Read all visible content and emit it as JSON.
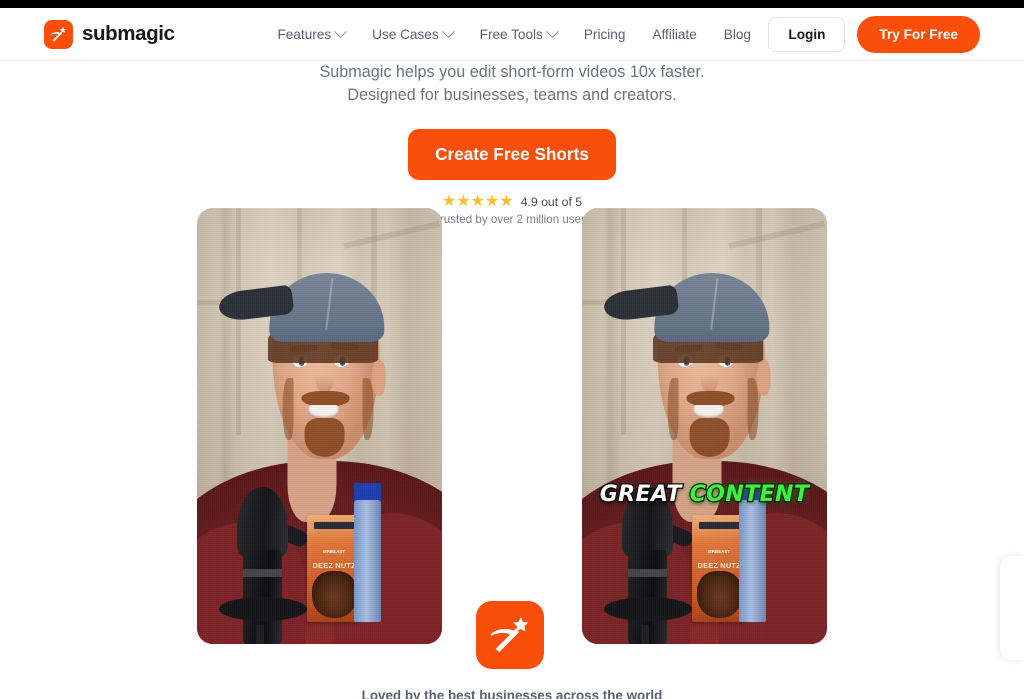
{
  "brand": {
    "name": "submagic",
    "logo_icon": "magic-wand-icon"
  },
  "nav": {
    "links": [
      {
        "label": "Features",
        "has_dropdown": true
      },
      {
        "label": "Use Cases",
        "has_dropdown": true
      },
      {
        "label": "Free Tools",
        "has_dropdown": true
      },
      {
        "label": "Pricing",
        "has_dropdown": false
      },
      {
        "label": "Affiliate",
        "has_dropdown": false
      },
      {
        "label": "Blog",
        "has_dropdown": false
      }
    ],
    "login_label": "Login",
    "try_label": "Try For Free"
  },
  "hero": {
    "subtitle_line1": "Submagic helps you edit short-form videos 10x faster.",
    "subtitle_line2": "Designed for businesses, teams and creators.",
    "cta_label": "Create Free Shorts",
    "stars": "★★★★★",
    "rating_text": "4.9 out of 5",
    "trusted_text": "Trusted by over 2 million users"
  },
  "comparison": {
    "left_video_alt": "original-video-before",
    "right_video_alt": "captioned-video-after",
    "center_icon": "magic-wand-icon",
    "caption_word1": "GREAT",
    "caption_word2": "CONTENT",
    "product_label_top": "MRBEAST",
    "product_label_main": "DEEZ NUTZ"
  },
  "footer": {
    "loved_by_text": "Loved by the best businesses across the world"
  },
  "colors": {
    "brand_orange": "#FA4E0B",
    "star_gold": "#FBBE2C",
    "caption_green": "#3FF23F",
    "text_muted": "#6B7280",
    "text_dark": "#16181D"
  }
}
